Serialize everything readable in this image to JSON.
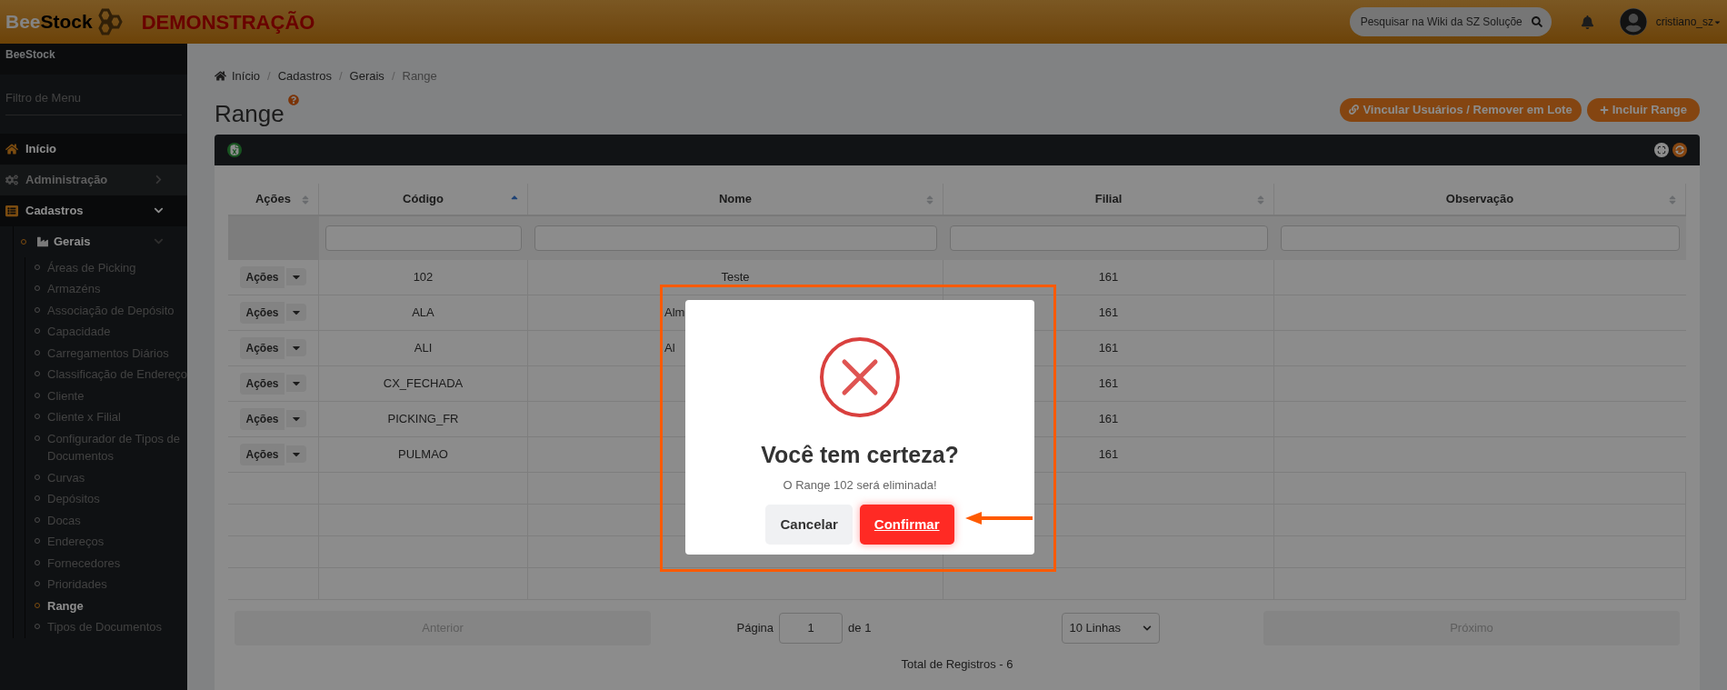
{
  "header": {
    "logo_parts": [
      "Bee",
      "Stock"
    ],
    "demo_label": "DEMONSTRAÇÃO",
    "search": {
      "placeholder": "Pesquisar na Wiki da SZ Soluçõe"
    },
    "user": "cristiano_sz"
  },
  "sidebar": {
    "app_name": "BeeStock",
    "filter": {
      "placeholder": "Filtro de Menu"
    },
    "items": [
      {
        "label": "Início",
        "selected": true,
        "expanded": false
      },
      {
        "label": "Administração",
        "selected": false,
        "expanded": false
      },
      {
        "label": "Cadastros",
        "selected": false,
        "expanded": true,
        "children": [
          {
            "label": "Gerais",
            "expanded": true,
            "children": [
              {
                "label": "Áreas de Picking",
                "selected": false
              },
              {
                "label": "Armazéns",
                "selected": false
              },
              {
                "label": "Associação de Depósito",
                "selected": false
              },
              {
                "label": "Capacidade",
                "selected": false
              },
              {
                "label": "Carregamentos Diários",
                "selected": false
              },
              {
                "label": "Classificação de Endereço",
                "selected": false
              },
              {
                "label": "Cliente",
                "selected": false
              },
              {
                "label": "Cliente x Filial",
                "selected": false
              },
              {
                "label": "Configurador de Tipos de Documentos",
                "selected": false
              },
              {
                "label": "Curvas",
                "selected": false
              },
              {
                "label": "Depósitos",
                "selected": false
              },
              {
                "label": "Docas",
                "selected": false
              },
              {
                "label": "Endereços",
                "selected": false
              },
              {
                "label": "Fornecedores",
                "selected": false
              },
              {
                "label": "Prioridades",
                "selected": false
              },
              {
                "label": "Range",
                "selected": true
              },
              {
                "label": "Tipos de Documentos",
                "selected": false
              }
            ]
          }
        ]
      }
    ]
  },
  "breadcrumb": {
    "separator": "/",
    "items": [
      "Início",
      "Cadastros",
      "Gerais",
      "Range"
    ]
  },
  "title": "Range",
  "actions": [
    "Vincular Usuários / Remover em Lote",
    "Incluir Range"
  ],
  "table": {
    "columns": [
      {
        "label": "Ações",
        "sorted": false
      },
      {
        "label": "Código",
        "sorted": true
      },
      {
        "label": "Nome",
        "sorted": false
      },
      {
        "label": "Filial",
        "sorted": false
      },
      {
        "label": "Observação",
        "sorted": false
      }
    ],
    "rows": [
      {
        "action": "Ações",
        "code": "102",
        "name": "Teste",
        "name_clipped": false,
        "branch": "161"
      },
      {
        "action": "Ações",
        "code": "ALA",
        "name": "Alm",
        "name_clipped": true,
        "branch": "161"
      },
      {
        "action": "Ações",
        "code": "ALI",
        "name": "Al",
        "name_clipped": true,
        "branch": "161"
      },
      {
        "action": "Ações",
        "code": "CX_FECHADA",
        "branch": "161"
      },
      {
        "action": "Ações",
        "code": "PICKING_FR",
        "branch": "161"
      },
      {
        "action": "Ações",
        "code": "PULMAO",
        "branch": "161"
      }
    ]
  },
  "pagination": {
    "previous": "Anterior",
    "page_label": "Página",
    "page": "1",
    "of": "de 1",
    "page_size": "10 Linhas",
    "next": "Próximo",
    "total": "Total de Registros - 6"
  },
  "dialog": {
    "title": "Você tem certeza?",
    "message": "O Range 102 será eliminada!",
    "buttons": [
      {
        "label": "Cancelar",
        "kind": "cancel"
      },
      {
        "label": "Confirmar",
        "kind": "confirm"
      }
    ]
  }
}
